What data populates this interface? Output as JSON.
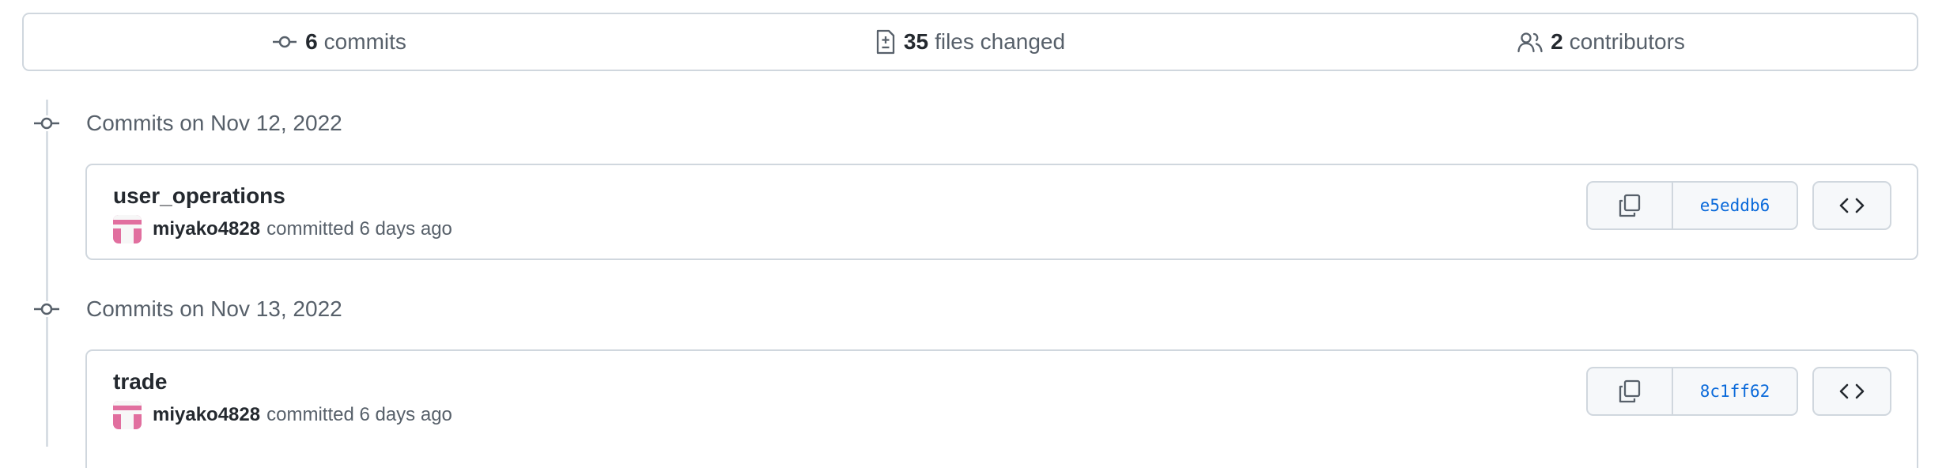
{
  "summary": {
    "commits": {
      "count": "6",
      "label": "commits",
      "icon": "git-commit-icon"
    },
    "files": {
      "count": "35",
      "label": "files changed",
      "icon": "file-diff-icon"
    },
    "contributors": {
      "count": "2",
      "label": "contributors",
      "icon": "people-icon"
    }
  },
  "groups": [
    {
      "title": "Commits on Nov 12, 2022",
      "commits": [
        {
          "message": "user_operations",
          "author": "miyako4828",
          "action": "committed 6 days ago",
          "sha": "e5eddb6"
        }
      ]
    },
    {
      "title": "Commits on Nov 13, 2022",
      "commits": [
        {
          "message": "trade",
          "author": "miyako4828",
          "action": "committed 6 days ago",
          "sha": "8c1ff62"
        }
      ]
    }
  ],
  "colors": {
    "border": "#d0d7de",
    "muted_text": "#57606a",
    "link": "#0969da",
    "avatar": "#e16f9f"
  }
}
